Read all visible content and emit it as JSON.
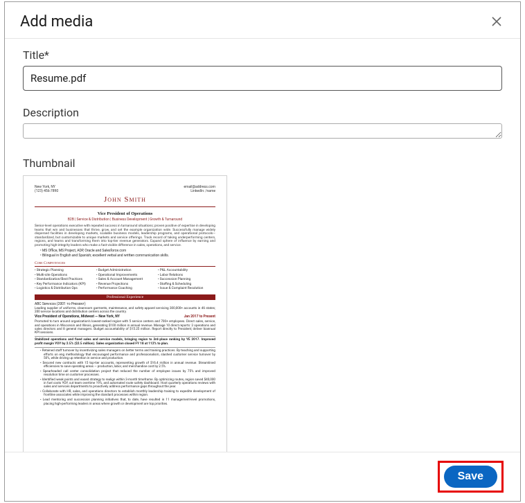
{
  "modal": {
    "title": "Add media",
    "close_icon": "close-icon"
  },
  "fields": {
    "title_label": "Title*",
    "title_value": "Resume.pdf",
    "description_label": "Description",
    "description_value": "",
    "thumbnail_label": "Thumbnail"
  },
  "resume_preview": {
    "name": "John Smith",
    "contact_left_city": "New York, NY",
    "contact_left_phone": "(123) 456-7890",
    "contact_right_email": "email@address.com",
    "contact_right_link": "LinkedIn: /name",
    "headline": "Vice President of Operations",
    "tagline": "B2B | Service & Distribution | Business Development | Growth & Turnaround",
    "summary_para": "Senior-level operations executive with repeated success in turnaround situations; proven positive of expertise in developing teams that win and businesses that thrive, grow, and set the example organization wide. Successfully manage widely dispersed facilities in developing markets, scalable business models, leadership programs, and operational protocols—standardized, but customizable to unique markets and service offerings. Track record of taking underperforming centers, regions, and teams and transforming them into top-tier revenue generators. Expand sphere of influence by earning and promoting high-integrity leaders who make a fast-visible difference in sales, operations, and service.",
    "summary_b1": "MS Office, MS Project, ADP, Oracle and Salesforce.com",
    "summary_b2": "Bilingual in English and Spanish; excellent verbal and written communication skills.",
    "core_hdr": "Core Competencies",
    "core_col1": [
      "• Strategic Planning",
      "• Multi-site Operations",
      "• Standardization/Best Practices",
      "• Key Performance Indicators (KPI)",
      "• Logistics & Distribution Ops"
    ],
    "core_col2": [
      "• Budget Administration",
      "• Operational Improvements",
      "• Sales & Account Management",
      "• Revenue Projections",
      "• Performance Coaching"
    ],
    "core_col3": [
      "• P&L Accountability",
      "• Labor Relations",
      "• Succession Planning",
      "• Staffing & Scheduling",
      "• Issue & Complaint Resolution"
    ],
    "exp_band": "Professional Experience",
    "company_line": "ABC Services (2001 to Present)",
    "company_desc": "Leading supplier of uniforms, cleanroom garments, maintenance, and safety apparel servicing 300,000+ accounts in 46 states; 200 service locations and distribution centers across the country.",
    "job_title": "Vice President of Operations, Midwest — New York, NY",
    "job_dates": "Jan 2017 to Present",
    "job_desc": "Promoted to turn around organization's lowest-ranked region with 5 service centers and 700+ employees. Direct sales, service, and operations in Wisconsin and Illinois, generating $100 million in annual revenue. Manage 10 direct reports: 2 operations and sales directors and 8 general managers. Budget accountability of $15.25 million. Report directly to President; deliver biannual KPI sessions.",
    "job_emph": "Stabilized operations and fixed sales and service models, bringing region to 3rd-place ranking by YE 2017. Improved profit margin YOY by 2.5% ($2.5 million). Sales organization closed FY 18 at 112% to plan.",
    "bullets": [
      "Retained staff turnover by incentivizing sales managers on better terms and training practices. By teaching and supporting efforts on eng methodology that encouraged performance and professionalism, slashed customer service turnover by 50%, while driving up retention in service and production.",
      "Secured new contracts with 15 top-tier accounts, representing growth of $16.4 million in annual revenue. Streamlined efficiencies to save operating areas — production, labor, and merchandise cost by 2.5%.",
      "Spearheaded call center consolidation project that reduced the number of employee issues by 75% and improved resolution time on customer processes.",
      "Identified weak points and eased strategy to realign within 3-month timeframe. By optimizing routes, region saved $40,000 in fuel costs YOY, cut team overtime 19%, and automated route safety dashboard. Host quarterly operations reviews with sales and services departments to proactively address performance gaps throughout the year.",
      "Collaborate with HR, sales, and operations directors to establish monthly leadership training to expedite development of frontline associates while improving the standard processes within region.",
      "Lead mentoring and succession planning initiatives that, to date, have resulted in 11 management-level promotions, placing high-performing leaders in areas where growth or development are top priorities."
    ]
  },
  "footer": {
    "save_label": "Save"
  }
}
